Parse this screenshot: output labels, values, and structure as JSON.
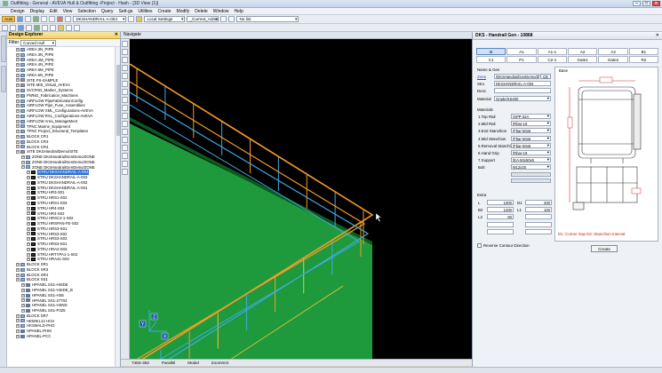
{
  "window": {
    "title": "Outfitting - General - AVEVA Hull & Outfitting -Project - Hash - [3D View (1)]",
    "min": "–",
    "max": "□",
    "close": "✕"
  },
  "menu": [
    "Design",
    "Display",
    "Edit",
    "View",
    "Selection",
    "Query",
    "Sett-gs",
    "Utilities",
    "Create",
    "Modify",
    "Delete",
    "Window",
    "Help"
  ],
  "toolbar": {
    "auto_label": "Auto",
    "element_combo": "DKSHANDRAIL-A-004",
    "settings_combo": "Local Settings",
    "admin_combo": "_Current_Admin",
    "list_combo": "No list"
  },
  "explorer": {
    "title": "Design Explorer",
    "close": "✕",
    "filter_label": "Filter",
    "filter_value": "Curved Hull",
    "items": [
      {
        "indent": 1,
        "label": "AREA 3N_PIPE"
      },
      {
        "indent": 1,
        "label": "AREA 3N_PIPE"
      },
      {
        "indent": 1,
        "label": "AREA 4M_PIPE"
      },
      {
        "indent": 1,
        "label": "AREA 4N_PIPE"
      },
      {
        "indent": 1,
        "label": "AREA 6M_PIPE"
      },
      {
        "indent": 1,
        "label": "AREA 6N_PIPE"
      },
      {
        "indent": 1,
        "label": "SITE PS-SAMPLE"
      },
      {
        "indent": 1,
        "label": "SITE MIS_Virtual_AVEVA"
      },
      {
        "indent": 1,
        "label": "SVCPAD_Marker_Systems"
      },
      {
        "indent": 1,
        "label": "PWNG_Fabrication_Machines"
      },
      {
        "indent": 1,
        "label": "AIRFLOW PipeFabricationConfig"
      },
      {
        "indent": 1,
        "label": "AIRFLOW Pipe_Fuse_Assemblies"
      },
      {
        "indent": 1,
        "label": "AIRFLOW XML_Configurations-AVEVA"
      },
      {
        "indent": 1,
        "label": "AIRFLOW RXL_Configurations-AVEVA"
      },
      {
        "indent": 1,
        "label": "AIRFLOW Area_ManageMent"
      },
      {
        "indent": 1,
        "label": "TPNC Marine_Equipment"
      },
      {
        "indent": 1,
        "label": "TPNC Project_Structural_Templates"
      },
      {
        "indent": 1,
        "label": "BLOCK CR1"
      },
      {
        "indent": 1,
        "label": "BLOCK CR3"
      },
      {
        "indent": 1,
        "label": "BLOCK CR4"
      },
      {
        "indent": 1,
        "label": "SITE DKSHandrailDemo/SITE"
      },
      {
        "indent": 2,
        "label": "ZONE DKSHandrailGenDemo/ZONE"
      },
      {
        "indent": 2,
        "label": "ZONE DKSHandrailGenDemo/ZONE"
      },
      {
        "indent": 2,
        "label": "ZONE DKSHandrailGenDemo/ZONE"
      },
      {
        "indent": 3,
        "label": "STRU DKSHANDRAIL-A-004",
        "selected": true
      },
      {
        "indent": 3,
        "label": "STRU DKSHANDRAIL-A-003"
      },
      {
        "indent": 3,
        "label": "STRU DKSHANDRAIL-A-002"
      },
      {
        "indent": 3,
        "label": "STRU DKSHANDRAIL-A-001"
      },
      {
        "indent": 3,
        "label": "STRU HR3-S01"
      },
      {
        "indent": 3,
        "label": "STRU HRS1-S02"
      },
      {
        "indent": 3,
        "label": "STRU HRS1-S03"
      },
      {
        "indent": 3,
        "label": "STRU HR4-S04"
      },
      {
        "indent": 3,
        "label": "STRU HR4-S02"
      },
      {
        "indent": 3,
        "label": "STRU HRSC2-1-S02"
      },
      {
        "indent": 3,
        "label": "STRU HRSPAN-FE-S02"
      },
      {
        "indent": 3,
        "label": "STRU HRS3-S01"
      },
      {
        "indent": 3,
        "label": "STRU HRS3-S02"
      },
      {
        "indent": 3,
        "label": "STRU HRS3-S03"
      },
      {
        "indent": 3,
        "label": "STRU HRS3-S01"
      },
      {
        "indent": 3,
        "label": "STRU HRA2-S03"
      },
      {
        "indent": 3,
        "label": "STRU HRTYPA1-1-S02"
      },
      {
        "indent": 3,
        "label": "STRU HRA41-S04"
      },
      {
        "indent": 1,
        "label": "BLOCK SR1"
      },
      {
        "indent": 1,
        "label": "BLOCK SR3"
      },
      {
        "indent": 1,
        "label": "BLOCK SR4"
      },
      {
        "indent": 1,
        "label": "BLOCK SS1"
      },
      {
        "indent": 2,
        "label": "HPANEL SS1-HSIDE"
      },
      {
        "indent": 2,
        "label": "HPANEL SS1-HSIDE_B"
      },
      {
        "indent": 2,
        "label": "HPANEL SS1-HS6"
      },
      {
        "indent": 2,
        "label": "HPANEL SS1-27704"
      },
      {
        "indent": 2,
        "label": "HPANEL SS1-HSND"
      },
      {
        "indent": 2,
        "label": "HPANEL SS1-P325"
      },
      {
        "indent": 1,
        "label": "BLOCK SR7"
      },
      {
        "indent": 1,
        "label": "HEMIKL12 HCH"
      },
      {
        "indent": 1,
        "label": "HKSMALD-PHO"
      },
      {
        "indent": 1,
        "label": "HPANEL-PHM"
      },
      {
        "indent": 1,
        "label": "HPANEL-PCC"
      }
    ]
  },
  "viewer": {
    "title": "Navigate",
    "status": [
      "745S-352",
      "Parallel",
      "Model",
      "Zoomrect"
    ],
    "axes": {
      "y": "Y",
      "z": "Z",
      "x": "X"
    },
    "colors": {
      "deck": "#1e9a3c",
      "top_rail": "#f39c2a",
      "mid_rail": "#3fa9e0",
      "stanchion": "#f4c430",
      "background": "#000000"
    }
  },
  "panel": {
    "title": "DKS - Handrail Gen - 10868",
    "close": "✕",
    "tabs": [
      "B",
      "A1",
      "A1-1",
      "A2",
      "A3",
      "B1",
      "C1",
      "P1",
      "C2-1",
      "Gate1",
      "Gate2",
      "R2"
    ],
    "active_tab": 0,
    "name_gen_label": "Name & Gen",
    "zone_label": "Zone",
    "zone_value": "/DKSHandrailGenDemo/ZC",
    "ce_button": "CE",
    "stru_label": "Stru",
    "stru_value": "DKSHANDRAIL-A-004",
    "desc_label": "Desc",
    "desc_value": "",
    "material_label": "Material",
    "material_value": "Grade/SS400",
    "materials_label": "Materials",
    "materials": [
      {
        "label": "1.Top Rail",
        "value": "/SPP-32A"
      },
      {
        "label": "2.Mid Rail",
        "value": "/Rbar-19"
      },
      {
        "label": "3.End Stanchion",
        "value": "/Fbar-50x6"
      },
      {
        "label": "4.Mid Stanchion",
        "value": "/Fbar-50x6"
      },
      {
        "label": "5.Removal Stanchi",
        "value": "/Fbar-50x6"
      },
      {
        "label": "6.Hand Grip",
        "value": "/Rbar-19"
      },
      {
        "label": "7.Support",
        "value": "/EA-50x50x5"
      },
      {
        "label": "Bolt",
        "value": "M12x25"
      }
    ],
    "extra_label": "Extra",
    "dims_left": [
      {
        "label": "L",
        "value": "1000"
      },
      {
        "label": "B2",
        "value": "1200"
      },
      {
        "label": "L2",
        "value": "60"
      },
      {
        "label": "",
        "value": ""
      },
      {
        "label": "",
        "value": ""
      }
    ],
    "dims_right": [
      {
        "label": "D1",
        "value": "200"
      },
      {
        "label": "L1",
        "value": "100"
      },
      {
        "label": "",
        "value": ""
      },
      {
        "label": "",
        "value": ""
      },
      {
        "label": "",
        "value": ""
      }
    ],
    "checkbox_label": "Reverse Contour Direction",
    "drawing_title": "Base",
    "drawing_caption": "D1: Corner Gap    D2: Stanchion Interval",
    "create_label": "Create"
  }
}
